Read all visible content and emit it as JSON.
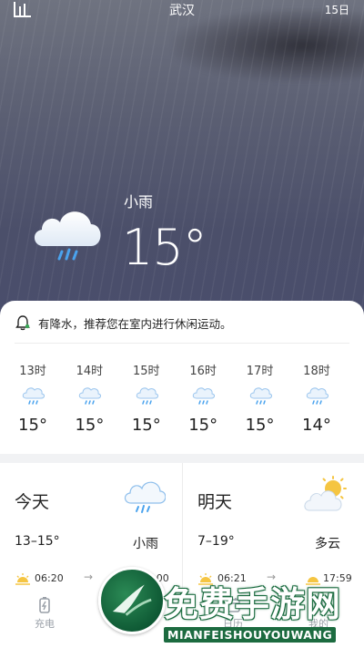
{
  "header": {
    "city": "武汉",
    "days_link": "15日",
    "stats_icon": "bar-chart-icon"
  },
  "current": {
    "condition": "小雨",
    "temperature": "15°",
    "icon": "rain-cloud-icon"
  },
  "alert": {
    "icon": "bell-icon",
    "text": "有降水，推荐您在室内进行休闲运动。"
  },
  "hourly": [
    {
      "time": "13时",
      "temp": "15°",
      "icon": "light-rain-icon"
    },
    {
      "time": "14时",
      "temp": "15°",
      "icon": "light-rain-icon"
    },
    {
      "time": "15时",
      "temp": "15°",
      "icon": "light-rain-icon"
    },
    {
      "time": "16时",
      "temp": "15°",
      "icon": "light-rain-icon"
    },
    {
      "time": "17时",
      "temp": "15°",
      "icon": "light-rain-icon"
    },
    {
      "time": "18时",
      "temp": "14°",
      "icon": "light-rain-icon"
    }
  ],
  "days": [
    {
      "label": "今天",
      "range": "13–15°",
      "condition": "小雨",
      "sunrise": "06:20",
      "sunset": "18:00",
      "icon": "rain-cloud-icon"
    },
    {
      "label": "明天",
      "range": "7–19°",
      "condition": "多云",
      "sunrise": "06:21",
      "sunset": "17:59",
      "icon": "partly-cloudy-icon"
    }
  ],
  "tabbar": {
    "tabs": [
      {
        "label": "充电",
        "icon": "battery-icon"
      },
      {
        "label": "日历",
        "icon": "calendar-icon"
      },
      {
        "label": "我的",
        "icon": "user-icon"
      }
    ]
  },
  "watermark": {
    "title": "免费手游网",
    "subtitle": "MIANFEISHOUYOUWANG"
  },
  "colors": {
    "sky_top": "#6f7380",
    "sky_bottom": "#4a4e6c",
    "watermark_green": "#1c6b40"
  }
}
